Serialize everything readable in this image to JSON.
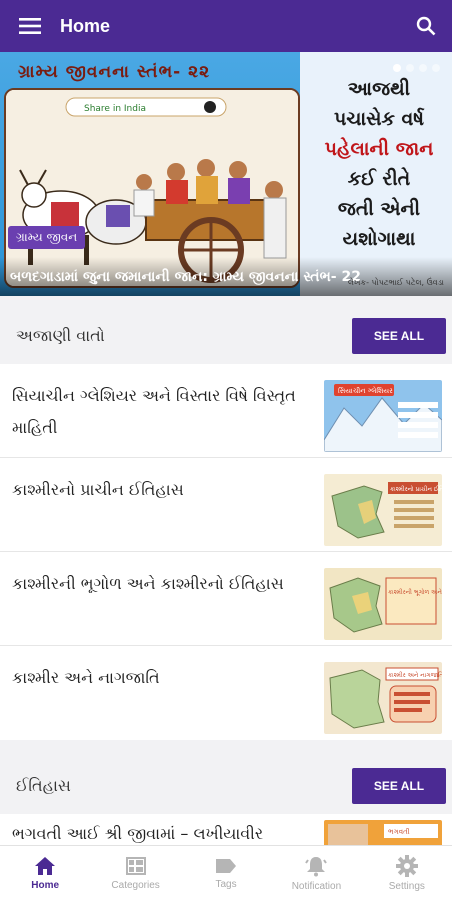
{
  "appbar": {
    "title": "Home"
  },
  "banner": {
    "heading": "ગ્રામ્ય જીવનના સ્તંભ- ૨૨",
    "right_lines": [
      "આજથી",
      "પચાસેક વર્ષ",
      "પહેલાની જાન",
      "કઈ રીતે",
      "જતી એની",
      "યશોગાથા"
    ],
    "tag": "ગ્રામ્ય જીવન",
    "caption": "બળદગાડામાં જુના જમાનાની જાન: ગ્રામ્ય જીવનના સ્તંભ- 22",
    "credit": "લેખક- પોપટભાઈ પટેલ, ઉંવડા",
    "share": "Share in India"
  },
  "section1": {
    "title": "અજાણી વાતો",
    "see_all": "SEE ALL",
    "items": [
      {
        "title": "સિયાચીન ગ્લેશિયર અને વિસ્તાર વિષે વિસ્તૃત માહિતી",
        "thumb": "સિયાચીન ગ્લેશિયર"
      },
      {
        "title": "કાશ્મીરનો પ્રાચીન ઈતિહાસ",
        "thumb": "કાશ્મીરનો પ્રાચીન ઈતિહાસ"
      },
      {
        "title": "કાશ્મીરની ભૂગોળ અને કાશ્મીરનો ઈતિહાસ",
        "thumb": "કાશ્મીરની ભૂગોળ અને ઈતિહાસ"
      },
      {
        "title": "કાશ્મીર અને નાગજાતિ",
        "thumb": "કાશ્મીર અને નાગજાતિ"
      }
    ]
  },
  "section2": {
    "title": "ઈતિહાસ",
    "see_all": "SEE ALL",
    "items": [
      {
        "title": "ભગવતી આઈ શ્રી જીવામાં – લખીયાવીર",
        "thumb": "ભગવતી"
      }
    ]
  },
  "nav": {
    "items": [
      {
        "label": "Home",
        "icon": "home-icon",
        "active": true
      },
      {
        "label": "Categories",
        "icon": "categories-icon"
      },
      {
        "label": "Tags",
        "icon": "tag-icon"
      },
      {
        "label": "Notification",
        "icon": "bell-icon"
      },
      {
        "label": "Settings",
        "icon": "gear-icon"
      }
    ]
  },
  "colors": {
    "primary": "#4b2a93",
    "background": "#f2f2f4",
    "inactive": "#aaaaaa"
  }
}
